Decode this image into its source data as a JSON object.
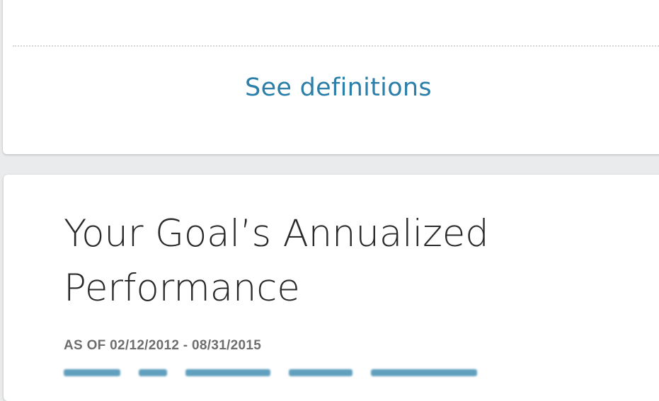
{
  "definitions_card": {
    "see_definitions_label": "See definitions"
  },
  "performance_card": {
    "title_line1": "Your Goal’s Annualized",
    "title_line2": "Performance",
    "as_of": "AS OF 02/12/2012 - 08/31/2015"
  },
  "colors": {
    "link": "#2b7fa8",
    "title": "#2a2a2a",
    "muted": "#6e6e6e",
    "background": "#e9ebec",
    "card": "#ffffff"
  }
}
